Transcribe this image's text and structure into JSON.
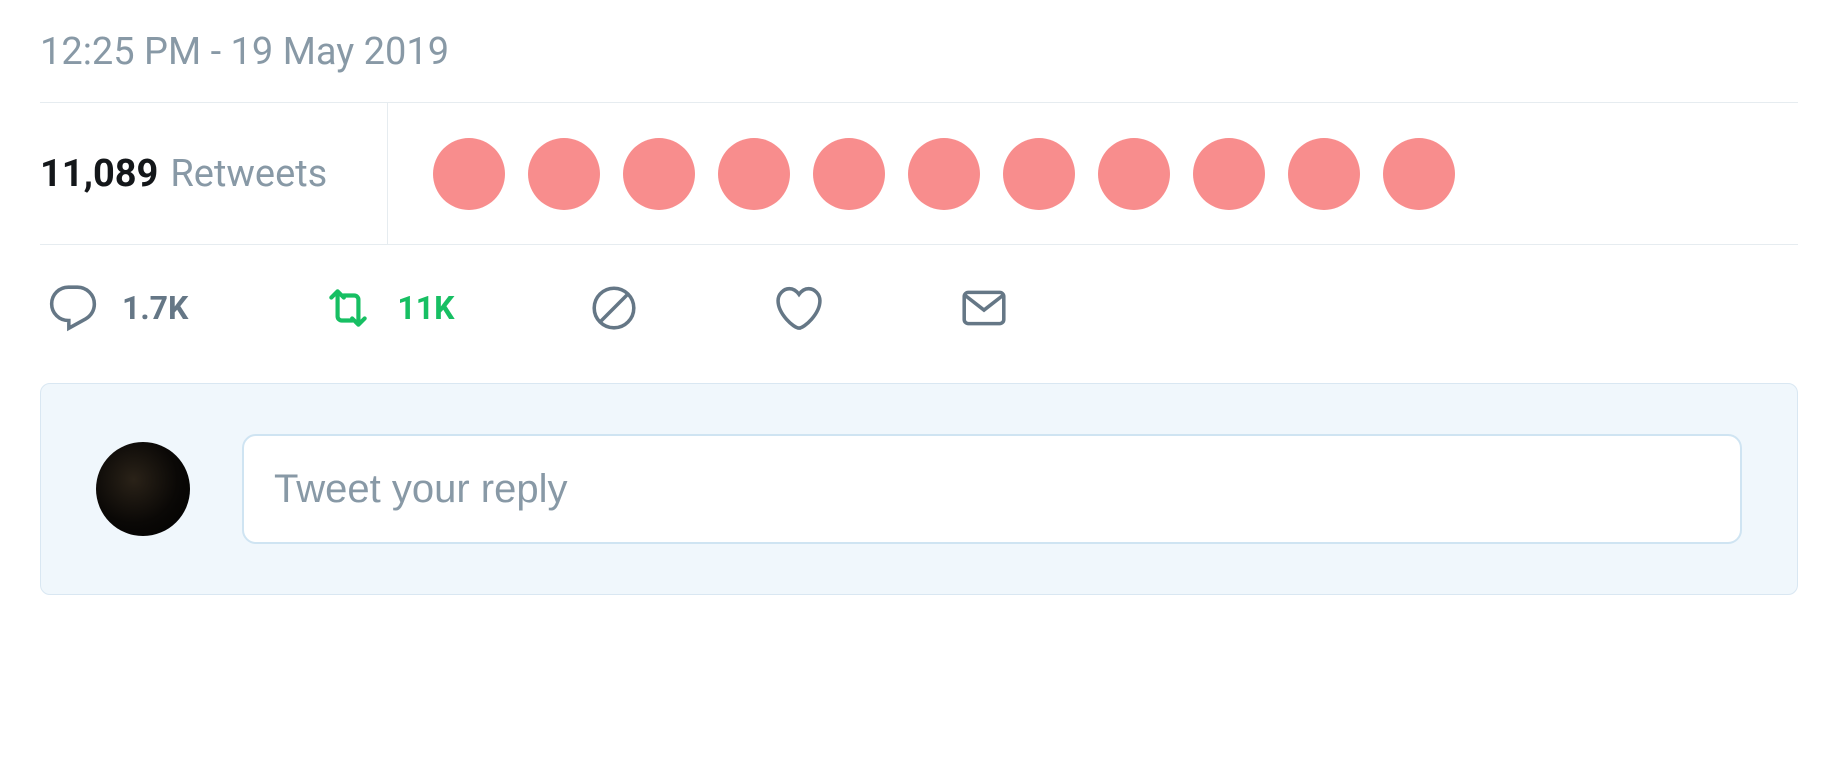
{
  "timestamp": "12:25 PM - 19 May 2019",
  "stats": {
    "count": "11,089",
    "label": "Retweets"
  },
  "avatar_count": 11,
  "actions": {
    "reply_count": "1.7K",
    "retweet_count": "11K"
  },
  "reply": {
    "placeholder": "Tweet your reply"
  },
  "colors": {
    "retweet_active": "#17bf63",
    "avatar_dot": "#f88d8d",
    "icon_gray": "#657786"
  }
}
